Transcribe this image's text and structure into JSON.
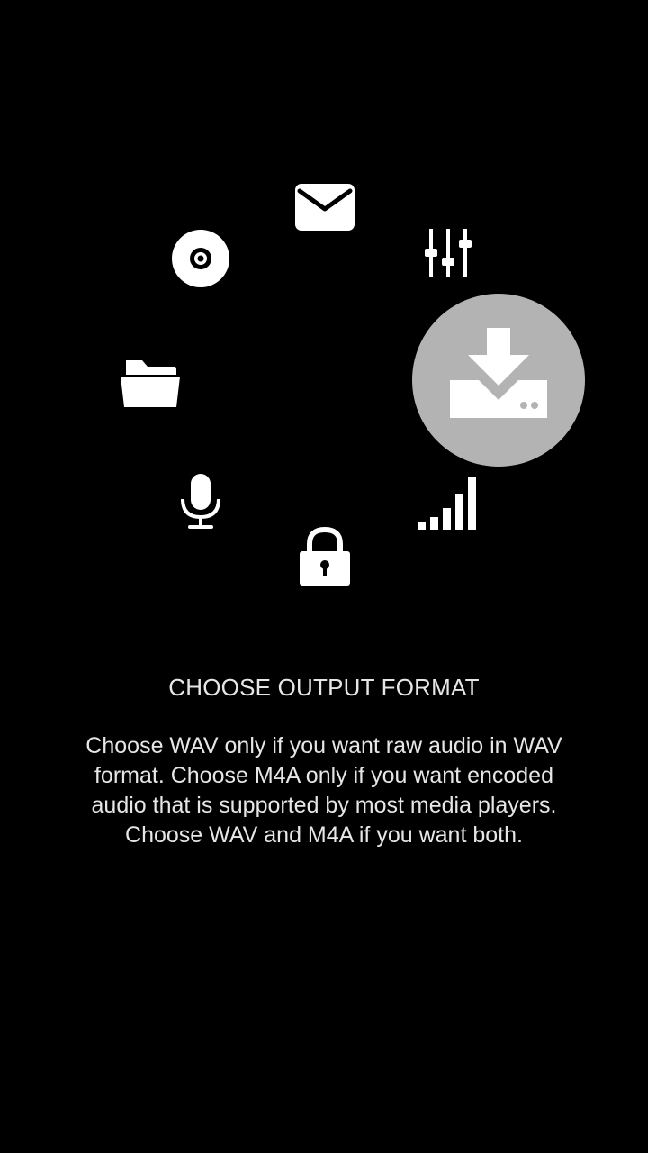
{
  "feature_wheel": {
    "icons": [
      "mail-icon",
      "equalizer-icon",
      "disc-icon",
      "folder-icon",
      "download-icon",
      "mic-icon",
      "lock-icon",
      "signal-icon"
    ],
    "selected_icon": "download-icon",
    "highlight_color": "#b3b3b3",
    "icon_color": "#ffffff"
  },
  "onboarding": {
    "title": "CHOOSE OUTPUT FORMAT",
    "description": "Choose WAV only if you want raw audio in WAV format. Choose M4A only if you want encoded audio that is supported by most media players. Choose WAV and M4A if you want both."
  }
}
